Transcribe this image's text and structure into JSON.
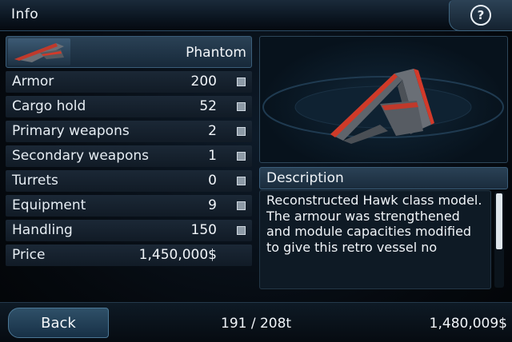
{
  "header": {
    "title": "Info",
    "help_glyph": "?"
  },
  "ship": {
    "name": "Phantom"
  },
  "stats": [
    {
      "label": "Armor",
      "value": "200"
    },
    {
      "label": "Cargo hold",
      "value": "52"
    },
    {
      "label": "Primary weapons",
      "value": "2"
    },
    {
      "label": "Secondary weapons",
      "value": "1"
    },
    {
      "label": "Turrets",
      "value": "0"
    },
    {
      "label": "Equipment",
      "value": "9"
    },
    {
      "label": "Handling",
      "value": "150"
    }
  ],
  "price": {
    "label": "Price",
    "value": "1,450,000$"
  },
  "description": {
    "title": "Description",
    "text": "Reconstructed Hawk class model. The armour was strengthened and module capacities modified to give this retro vessel no"
  },
  "footer": {
    "back_label": "Back",
    "cargo": "191 / 208t",
    "credits": "1,480,009$"
  },
  "icons": {
    "help": "help-icon",
    "ship_thumb": "ship-thumbnail-icon",
    "ship_model": "ship-model-render"
  },
  "colors": {
    "ship_hull": "#5c6168",
    "ship_accent": "#d23a2a",
    "panel_border": "#3b5e7a"
  }
}
